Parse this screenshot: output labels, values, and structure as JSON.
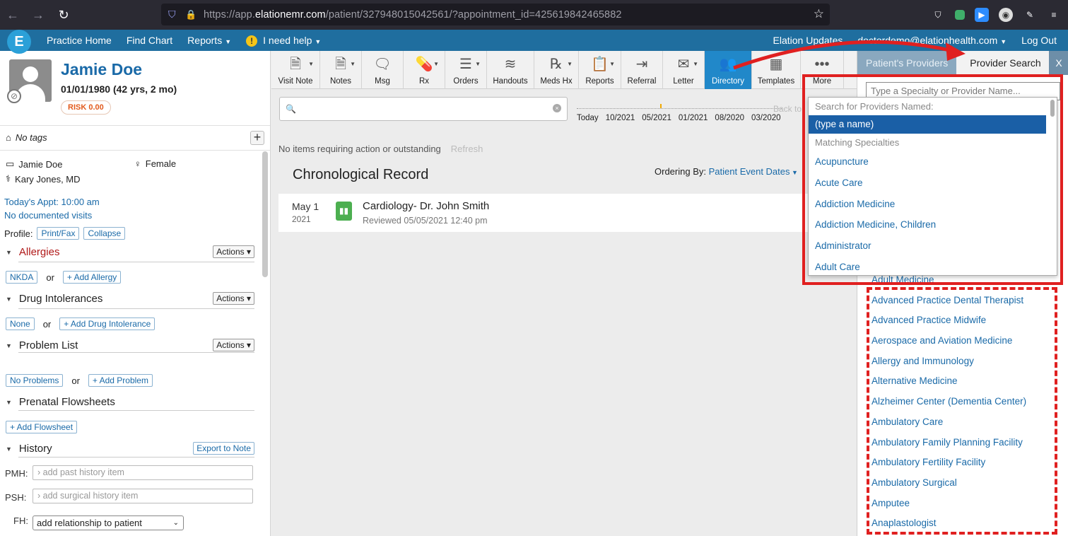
{
  "browser": {
    "url_prefix": "https://app.",
    "url_domain": "elationemr.com",
    "url_path": "/patient/327948015042561/?appointment_id=425619842465882"
  },
  "nav": {
    "logo": "E",
    "left": [
      "Practice Home",
      "Find Chart",
      "Reports",
      "I need help"
    ],
    "right": [
      "Elation Updates",
      "doctordemo@elationhealth.com",
      "Log Out"
    ]
  },
  "patient": {
    "name": "Jamie Doe",
    "dob": "01/01/1980 (42 yrs, 2 mo)",
    "risk": "RISK 0.00",
    "tags": "No tags",
    "display_name": "Jamie Doe",
    "gender": "Female",
    "provider": "Kary Jones, MD",
    "appt": "Today's Appt: 10:00 am",
    "visits": "No documented visits",
    "profile_label": "Profile:",
    "print_fax": "Print/Fax",
    "collapse": "Collapse"
  },
  "sections": {
    "actions": "Actions",
    "or": "or",
    "allergies": {
      "title": "Allergies",
      "btn1": "NKDA",
      "btn2": "+ Add Allergy"
    },
    "drug": {
      "title": "Drug Intolerances",
      "btn1": "None",
      "btn2": "+ Add Drug Intolerance"
    },
    "problems": {
      "title": "Problem List",
      "btn1": "No Problems",
      "btn2": "+ Add Problem"
    },
    "prenatal": {
      "title": "Prenatal Flowsheets",
      "btn": "+ Add Flowsheet"
    },
    "history": {
      "title": "History",
      "export": "Export to Note",
      "pmh_label": "PMH:",
      "pmh_placeholder": "add past history item",
      "psh_label": "PSH:",
      "psh_placeholder": "add surgical history item",
      "fh_label": "FH:",
      "fh_value": "add relationship to patient"
    }
  },
  "toolbar": [
    {
      "label": "Visit Note",
      "icon": "note-icon",
      "glyph": "🗎",
      "caret": true
    },
    {
      "label": "Notes",
      "icon": "notes-icon",
      "glyph": "🗎",
      "caret": true
    },
    {
      "label": "Msg",
      "icon": "message-icon",
      "glyph": "🗨",
      "caret": false
    },
    {
      "label": "Rx",
      "icon": "pill-icon",
      "glyph": "💊",
      "caret": true
    },
    {
      "label": "Orders",
      "icon": "orders-icon",
      "glyph": "☰",
      "caret": true
    },
    {
      "label": "Handouts",
      "icon": "layers-icon",
      "glyph": "≋",
      "caret": false
    },
    {
      "label": "Meds Hx",
      "icon": "meds-history-icon",
      "glyph": "℞",
      "caret": true
    },
    {
      "label": "Reports",
      "icon": "reports-icon",
      "glyph": "📋",
      "caret": true
    },
    {
      "label": "Referral",
      "icon": "referral-icon",
      "glyph": "⇥",
      "caret": false
    },
    {
      "label": "Letter",
      "icon": "envelope-icon",
      "glyph": "✉",
      "caret": true
    },
    {
      "label": "Directory",
      "icon": "directory-icon",
      "glyph": "👥",
      "caret": false,
      "active": true
    },
    {
      "label": "Templates",
      "icon": "templates-icon",
      "glyph": "▦",
      "caret": false
    },
    {
      "label": "More",
      "icon": "more-icon",
      "glyph": "•••",
      "caret": false
    }
  ],
  "center": {
    "timeline": [
      "Today",
      "10/2021",
      "05/2021",
      "01/2021",
      "08/2020",
      "03/2020"
    ],
    "back_to": "Back to",
    "status": "No items requiring action or outstanding",
    "refresh": "Refresh",
    "title": "Chronological Record",
    "ordering_label": "Ordering By:",
    "ordering_value": "Patient Event Dates",
    "record": {
      "month_day": "May 1",
      "year": "2021",
      "title": "Cardiology- Dr. John Smith",
      "subtitle": "Reviewed 05/05/2021 12:40 pm"
    }
  },
  "right_panel": {
    "tab1": "Patient's Providers",
    "tab2": "Provider Search",
    "close": "X",
    "placeholder": "Type a Specialty or Provider Name...",
    "list": [
      "Adult Medicine",
      "Advanced Practice Dental Therapist",
      "Advanced Practice Midwife",
      "Aerospace and Aviation Medicine",
      "Allergy and Immunology",
      "Alternative Medicine",
      "Alzheimer Center (Dementia Center)",
      "Ambulatory Care",
      "Ambulatory Family Planning Facility",
      "Ambulatory Fertility Facility",
      "Ambulatory Surgical",
      "Amputee",
      "Anaplastologist"
    ]
  },
  "dropdown": {
    "head1": "Search for Providers Named:",
    "selected": "(type a name)",
    "head2": "Matching Specialties",
    "items": [
      "Acupuncture",
      "Acute Care",
      "Addiction Medicine",
      "Addiction Medicine, Children",
      "Administrator",
      "Adult Care"
    ]
  }
}
